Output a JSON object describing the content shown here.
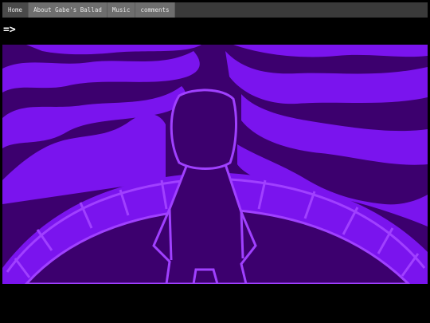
{
  "nav": {
    "items": [
      {
        "label": "Home"
      },
      {
        "label": "About Gabe's Ballad"
      },
      {
        "label": "Music"
      },
      {
        "label": "comments"
      }
    ]
  },
  "prompt": {
    "text": "=>"
  },
  "scene": {
    "colors": {
      "dark_purple": "#3c006e",
      "bright_purple": "#7a14ee",
      "outline": "#a040ff",
      "background": "#000000"
    }
  }
}
